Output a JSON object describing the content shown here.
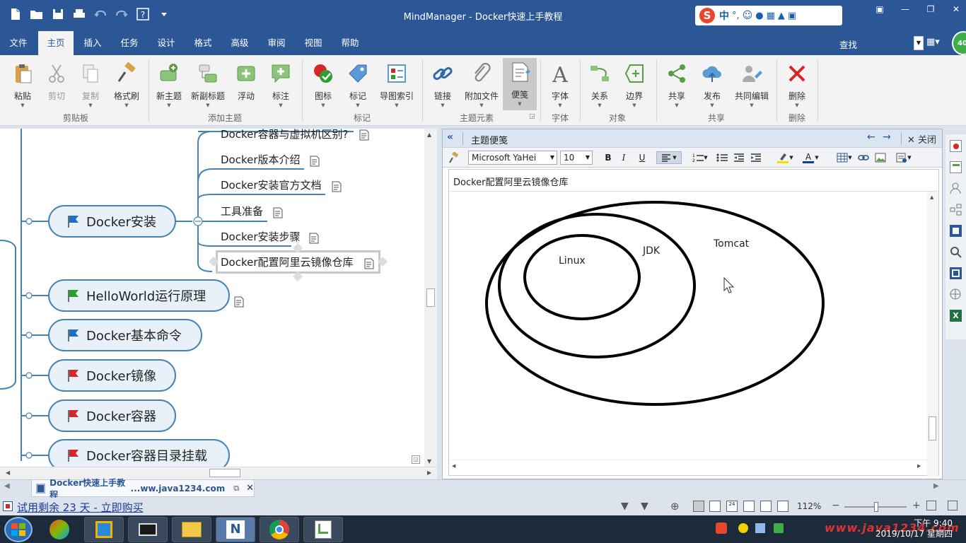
{
  "window": {
    "title": "MindManager - Docker快速上手教程",
    "controls": [
      "restore",
      "minimize",
      "maximize",
      "close"
    ]
  },
  "ime": {
    "label": "中",
    "punct": "°,"
  },
  "menu": {
    "tabs": [
      "文件",
      "主页",
      "插入",
      "任务",
      "设计",
      "格式",
      "高级",
      "审阅",
      "视图",
      "帮助"
    ],
    "active": "主页",
    "find_label": "查找",
    "avatar": "40"
  },
  "ribbon": {
    "groups": [
      {
        "label": "剪贴板",
        "buttons": [
          "粘贴",
          "剪切",
          "复制",
          "格式刷"
        ]
      },
      {
        "label": "添加主题",
        "buttons": [
          "新主题",
          "新副标题",
          "浮动",
          "标注"
        ]
      },
      {
        "label": "标记",
        "buttons": [
          "图标",
          "标记",
          "导图索引"
        ]
      },
      {
        "label": "主题元素",
        "buttons": [
          "链接",
          "附加文件",
          "便笺"
        ]
      },
      {
        "label": "字体",
        "buttons": [
          "字体"
        ]
      },
      {
        "label": "对象",
        "buttons": [
          "关系",
          "边界"
        ]
      },
      {
        "label": "共享",
        "buttons": [
          "共享",
          "发布",
          "共同编辑"
        ]
      },
      {
        "label": "删除",
        "buttons": [
          "删除"
        ]
      }
    ],
    "selected": "便笺"
  },
  "map": {
    "main_topics": [
      {
        "label": "Docker安装",
        "flag": "#1f6fc5"
      },
      {
        "label": "HelloWorld运行原理",
        "flag": "#2ca02c"
      },
      {
        "label": "Docker基本命令",
        "flag": "#1f6fc5"
      },
      {
        "label": "Docker镜像",
        "flag": "#d62728"
      },
      {
        "label": "Docker容器",
        "flag": "#d62728"
      },
      {
        "label": "Docker容器目录挂载",
        "flag": "#d62728"
      }
    ],
    "subtopics": [
      "Docker容器与虚拟机区别?",
      "Docker版本介绍",
      "Docker安装官方文档",
      "工具准备",
      "Docker安装步骤",
      "Docker配置阿里云镜像仓库"
    ],
    "selected_subtopic": "Docker配置阿里云镜像仓库"
  },
  "note_pane": {
    "header": "主题便笺",
    "close_label": "关闭",
    "font": "Microsoft YaHei",
    "size": "10",
    "topic_title": "Docker配置阿里云镜像仓库",
    "diagram_labels": [
      "Linux",
      "JDK",
      "Tomcat"
    ]
  },
  "doc_tab": {
    "name": "Docker快速上手教程",
    "path": "...ww.java1234.com"
  },
  "status": {
    "trial_text": "试用剩余 23 天 - 立即购买",
    "zoom": "112%"
  },
  "taskbar": {
    "time": "下午 9:40",
    "date": "2019/10/17 星期四",
    "watermark": "www.java1234.com"
  }
}
